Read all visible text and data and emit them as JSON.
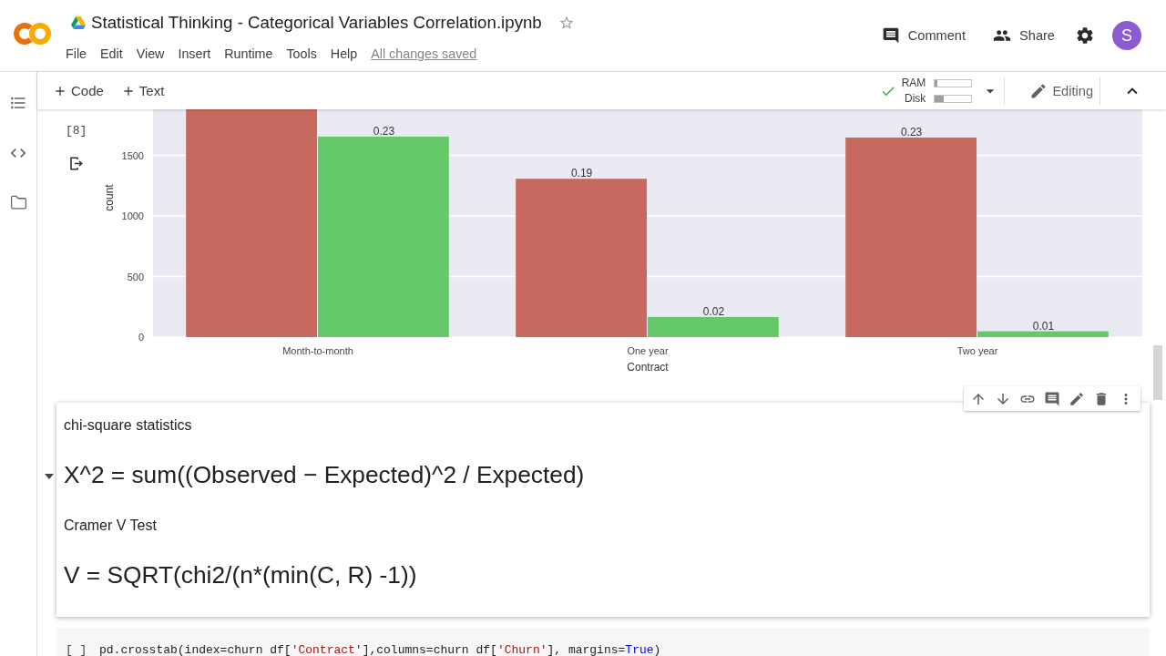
{
  "header": {
    "title": "Statistical Thinking - Categorical Variables Correlation.ipynb",
    "starred": false,
    "menu": [
      "File",
      "Edit",
      "View",
      "Insert",
      "Runtime",
      "Tools",
      "Help"
    ],
    "save_status": "All changes saved",
    "actions": [
      {
        "kind": "comment",
        "label": "Comment"
      },
      {
        "kind": "share",
        "label": "Share"
      }
    ],
    "avatar": "S"
  },
  "toolbar": {
    "insert": [
      {
        "label": "Code"
      },
      {
        "label": "Text"
      }
    ],
    "runtime": {
      "connected": true,
      "meters": [
        {
          "label": "RAM",
          "level": 0.06
        },
        {
          "label": "Disk",
          "level": 0.25
        }
      ]
    },
    "mode": "Editing"
  },
  "cells": [
    {
      "kind": "output",
      "execution_count": "[8]",
      "chart_data": [
        {
          "type": "bar",
          "xlabel": "Contract",
          "ylabel": "count",
          "categories": [
            "Month-to-month",
            "One year",
            "Two year"
          ],
          "series": [
            {
              "color": "#c8695f",
              "values": [
                1880,
                1307,
                1647
              ]
            },
            {
              "color": "#65c96a",
              "values": [
                1655,
                166,
                48
              ]
            }
          ],
          "ylim": [
            0,
            1880
          ],
          "yticks": [
            0,
            500,
            1000,
            1500
          ],
          "grid": true,
          "annotations": [
            "0.23",
            "0.19",
            "0.02",
            "0.23",
            "0.01"
          ]
        }
      ]
    },
    {
      "kind": "text",
      "expanded": true,
      "lines": [
        {
          "kind": "label",
          "text": "chi-square statistics"
        },
        {
          "kind": "formula",
          "text": "X^2 = sum((Observed − Expected)^2 / Expected)"
        },
        {
          "kind": "label",
          "text": "Cramer V Test"
        },
        {
          "kind": "formula",
          "text": "V = SQRT(chi2/(n*(min(C, R) -1))"
        }
      ]
    },
    {
      "kind": "code",
      "execution_count": "[ ]",
      "tokens": [
        {
          "kind": "plain",
          "text": "pd.crosstab(index=churn df["
        },
        {
          "kind": "string",
          "text": "'Contract'"
        },
        {
          "kind": "plain",
          "text": "],columns=churn df["
        },
        {
          "kind": "string",
          "text": "'Churn'"
        },
        {
          "kind": "plain",
          "text": "], margins="
        },
        {
          "kind": "keyword",
          "text": "True"
        },
        {
          "kind": "plain",
          "text": ")"
        }
      ]
    }
  ]
}
